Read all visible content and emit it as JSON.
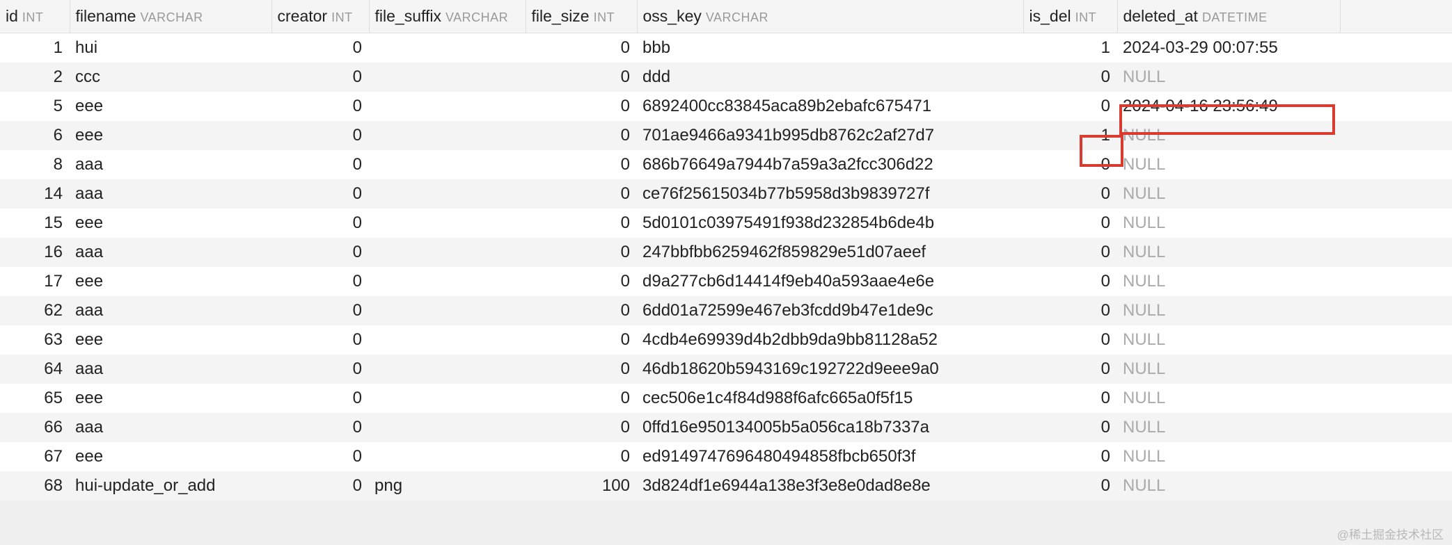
{
  "columns": [
    {
      "name": "id",
      "type": "INT"
    },
    {
      "name": "filename",
      "type": "VARCHAR"
    },
    {
      "name": "creator",
      "type": "INT"
    },
    {
      "name": "file_suffix",
      "type": "VARCHAR"
    },
    {
      "name": "file_size",
      "type": "INT"
    },
    {
      "name": "oss_key",
      "type": "VARCHAR"
    },
    {
      "name": "is_del",
      "type": "INT"
    },
    {
      "name": "deleted_at",
      "type": "DATETIME"
    }
  ],
  "rows": [
    {
      "id": "1",
      "filename": "hui",
      "creator": "0",
      "file_suffix": "",
      "file_size": "0",
      "oss_key": "bbb",
      "is_del": "1",
      "deleted_at": "2024-03-29 00:07:55"
    },
    {
      "id": "2",
      "filename": "ccc",
      "creator": "0",
      "file_suffix": "",
      "file_size": "0",
      "oss_key": "ddd",
      "is_del": "0",
      "deleted_at": null
    },
    {
      "id": "5",
      "filename": "eee",
      "creator": "0",
      "file_suffix": "",
      "file_size": "0",
      "oss_key": "6892400cc83845aca89b2ebafc675471",
      "is_del": "0",
      "deleted_at": "2024-04-16 23:56:49"
    },
    {
      "id": "6",
      "filename": "eee",
      "creator": "0",
      "file_suffix": "",
      "file_size": "0",
      "oss_key": "701ae9466a9341b995db8762c2af27d7",
      "is_del": "1",
      "deleted_at": null
    },
    {
      "id": "8",
      "filename": "aaa",
      "creator": "0",
      "file_suffix": "",
      "file_size": "0",
      "oss_key": "686b76649a7944b7a59a3a2fcc306d22",
      "is_del": "0",
      "deleted_at": null
    },
    {
      "id": "14",
      "filename": "aaa",
      "creator": "0",
      "file_suffix": "",
      "file_size": "0",
      "oss_key": "ce76f25615034b77b5958d3b9839727f",
      "is_del": "0",
      "deleted_at": null
    },
    {
      "id": "15",
      "filename": "eee",
      "creator": "0",
      "file_suffix": "",
      "file_size": "0",
      "oss_key": "5d0101c03975491f938d232854b6de4b",
      "is_del": "0",
      "deleted_at": null
    },
    {
      "id": "16",
      "filename": "aaa",
      "creator": "0",
      "file_suffix": "",
      "file_size": "0",
      "oss_key": "247bbfbb6259462f859829e51d07aeef",
      "is_del": "0",
      "deleted_at": null
    },
    {
      "id": "17",
      "filename": "eee",
      "creator": "0",
      "file_suffix": "",
      "file_size": "0",
      "oss_key": "d9a277cb6d14414f9eb40a593aae4e6e",
      "is_del": "0",
      "deleted_at": null
    },
    {
      "id": "62",
      "filename": "aaa",
      "creator": "0",
      "file_suffix": "",
      "file_size": "0",
      "oss_key": "6dd01a72599e467eb3fcdd9b47e1de9c",
      "is_del": "0",
      "deleted_at": null
    },
    {
      "id": "63",
      "filename": "eee",
      "creator": "0",
      "file_suffix": "",
      "file_size": "0",
      "oss_key": "4cdb4e69939d4b2dbb9da9bb81128a52",
      "is_del": "0",
      "deleted_at": null
    },
    {
      "id": "64",
      "filename": "aaa",
      "creator": "0",
      "file_suffix": "",
      "file_size": "0",
      "oss_key": "46db18620b5943169c192722d9eee9a0",
      "is_del": "0",
      "deleted_at": null
    },
    {
      "id": "65",
      "filename": "eee",
      "creator": "0",
      "file_suffix": "",
      "file_size": "0",
      "oss_key": "cec506e1c4f84d988f6afc665a0f5f15",
      "is_del": "0",
      "deleted_at": null
    },
    {
      "id": "66",
      "filename": "aaa",
      "creator": "0",
      "file_suffix": "",
      "file_size": "0",
      "oss_key": "0ffd16e950134005b5a056ca18b7337a",
      "is_del": "0",
      "deleted_at": null
    },
    {
      "id": "67",
      "filename": "eee",
      "creator": "0",
      "file_suffix": "",
      "file_size": "0",
      "oss_key": "ed9149747696480494858fbcb650f3f",
      "is_del": "0",
      "deleted_at": null
    },
    {
      "id": "68",
      "filename": "hui-update_or_add",
      "creator": "0",
      "file_suffix": "png",
      "file_size": "100",
      "oss_key": "3d824df1e6944a138e3f3e8e0dad8e8e",
      "is_del": "0",
      "deleted_at": null
    }
  ],
  "null_label": "NULL",
  "watermark": "@稀土掘金技术社区"
}
